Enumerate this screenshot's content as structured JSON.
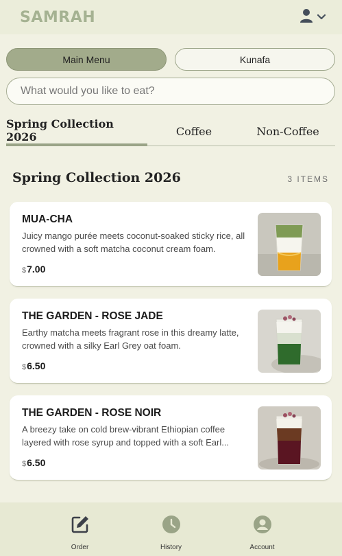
{
  "header": {
    "logo_text": "SAMRAH",
    "icon_color": "#444e5a"
  },
  "menu_toggle": {
    "main_label": "Main Menu",
    "secondary_label": "Kunafa",
    "active": "Main Menu"
  },
  "search": {
    "placeholder": "What would you like to eat?",
    "value": ""
  },
  "tabs": [
    {
      "label": "Spring Collection 2026",
      "active": true
    },
    {
      "label": "Coffee",
      "active": false
    },
    {
      "label": "Non-Coffee",
      "active": false
    }
  ],
  "section": {
    "title": "Spring Collection 2026",
    "count": "3 ITEMS"
  },
  "products": [
    {
      "name": "MUA-CHA",
      "description": "Juicy mango purée meets coconut-soaked sticky rice, all crowned with a soft matcha coconut cream foam.",
      "currency": "$",
      "price": "7.00",
      "image": "mango-matcha-drink-photo"
    },
    {
      "name": "THE GARDEN - ROSE JADE",
      "description": "Earthy matcha meets fragrant rose in this dreamy latte, crowned with a silky Earl Grey oat foam.",
      "currency": "$",
      "price": "6.50",
      "image": "rose-matcha-latte-photo"
    },
    {
      "name": "THE GARDEN - ROSE NOIR",
      "description": "A breezy take on cold brew-vibrant Ethiopian coffee layered with rose syrup and topped with a soft Earl...",
      "currency": "$",
      "price": "6.50",
      "image": "rose-cold-brew-photo"
    }
  ],
  "bottom_nav": [
    {
      "label": "Order",
      "icon": "edit-icon"
    },
    {
      "label": "History",
      "icon": "clock-icon"
    },
    {
      "label": "Account",
      "icon": "account-circle-icon"
    }
  ],
  "colors": {
    "background": "#f1f1e3",
    "accent": "#a2ab8b",
    "logo": "#a5b292",
    "nav_icon": "#9aa487"
  }
}
